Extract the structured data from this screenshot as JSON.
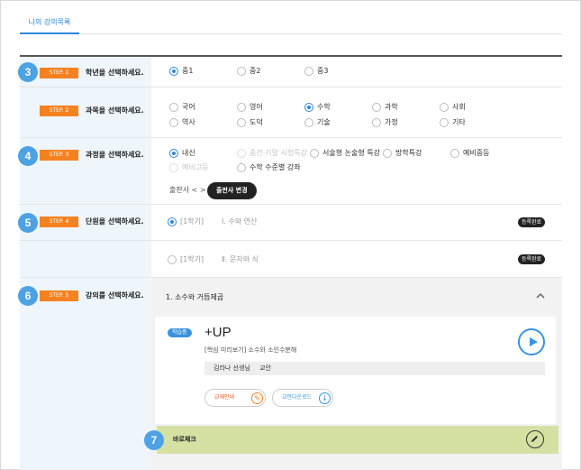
{
  "tab": {
    "label": "나의 강의목록"
  },
  "steps": {
    "s1": {
      "tag": "STEP. 1",
      "title": "학년을 선택하세요.",
      "marker": "3",
      "options": [
        "중1",
        "중2",
        "중3"
      ],
      "selected": 0
    },
    "s2": {
      "tag": "STEP. 2",
      "title": "과목을 선택하세요.",
      "options": [
        "국어",
        "영어",
        "수학",
        "과학",
        "사회",
        "역사",
        "도덕",
        "기술",
        "가정",
        "기타"
      ],
      "selected": 2
    },
    "s3": {
      "tag": "STEP. 3",
      "title": "과정을 선택하세요.",
      "marker": "4",
      "options": [
        "내신",
        "중간·기말 시험특강",
        "서술형 논술형 특강",
        "방학특강",
        "예비중등",
        "예비고등",
        "수학 수준별 강좌"
      ],
      "selected": 0,
      "publisher_label": "출판사 < >",
      "publisher_button": "출판사 변경"
    },
    "s4": {
      "tag": "STEP. 4",
      "title": "단원을 선택하세요.",
      "marker": "5",
      "units": [
        {
          "term": "[1학기]",
          "name": "Ⅰ. 수와 연산",
          "badge": "등록완료"
        },
        {
          "term": "[1학기]",
          "name": "Ⅱ. 문자와 식",
          "badge": "등록완료"
        }
      ]
    },
    "s5": {
      "tag": "STEP. 5",
      "title": "강의를 선택하세요.",
      "marker": "6",
      "lecture_group": "1. 소수와 거듭제곱",
      "card": {
        "pill": "학습중",
        "title": "+UP",
        "subtitle": "[핵심 미리보기] 소수와 소인수분해",
        "teacher": "김라나 선생님",
        "teacher_role": "교안",
        "btn1": "교재안내",
        "btn2": "교안다운로드"
      },
      "check": {
        "marker": "7",
        "label": "바로체크"
      }
    }
  },
  "icons": {
    "collapse": "chevron-up-icon",
    "play": "play-icon",
    "pencil": "pencil-icon",
    "download": "download-icon"
  },
  "colors": {
    "accent": "#2e86de",
    "step_tag": "#f58220",
    "marker": "#4da2e4",
    "check_bar": "#d5e1a3"
  }
}
